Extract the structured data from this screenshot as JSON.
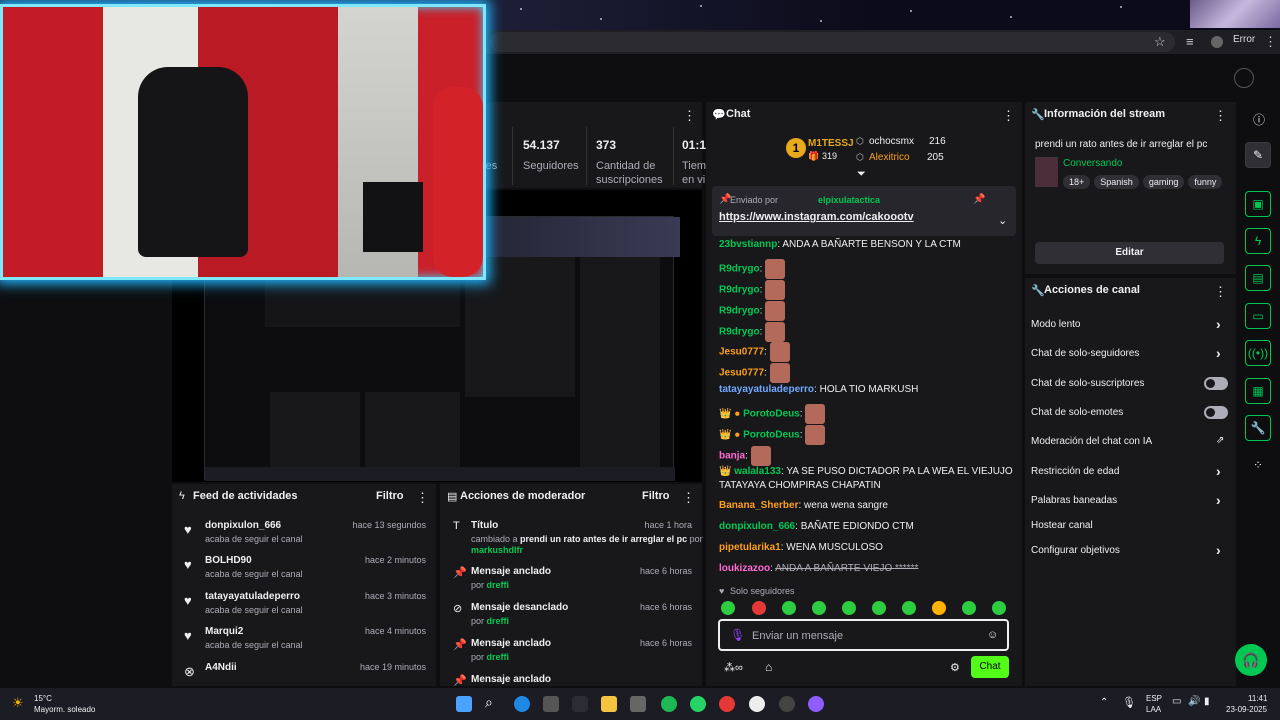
{
  "browser": {
    "error_label": "Error"
  },
  "stats": {
    "partial_label": "res",
    "followers_value": "54.137",
    "followers_label": "Seguidores",
    "subs_value": "373",
    "subs_label_1": "Cantidad de",
    "subs_label_2": "suscripciones",
    "time_value": "01:1",
    "time_label_1": "Tiem",
    "time_label_2": "en vi"
  },
  "chat": {
    "title": "Chat",
    "leader": {
      "rank": "1",
      "name": "M1TESSJ",
      "count": "319"
    },
    "gifter1": {
      "name": "ochocsmx",
      "count": "216"
    },
    "gifter2": {
      "name": "Alexitrico",
      "count": "205"
    },
    "pinned_by_label": "Enviado por",
    "pinned_user": "elpixulatactica",
    "pinned_link": "https://www.instagram.com/cakoootv",
    "messages": [
      {
        "user": "23bvstiannp",
        "text": "ANDA A BAÑARTE BENSON Y LA CTM"
      },
      {
        "user": "R9drygo",
        "text": ""
      },
      {
        "user": "R9drygo",
        "text": ""
      },
      {
        "user": "R9drygo",
        "text": ""
      },
      {
        "user": "R9drygo",
        "text": ""
      },
      {
        "user": "Jesu0777",
        "text": ""
      },
      {
        "user": "Jesu0777",
        "text": ""
      },
      {
        "user": "tatayayatuladeperro",
        "text": "HOLA TIO MARKUSH"
      },
      {
        "user": "PorotoDeus",
        "text": ""
      },
      {
        "user": "PorotoDeus",
        "text": ""
      },
      {
        "user": "banja",
        "text": ""
      },
      {
        "user": "walala133",
        "text": "YA SE PUSO DICTADOR PA LA WEA EL VIEJUJO"
      },
      {
        "user": "",
        "text": "TATAYAYA CHOMPIRAS CHAPATIN"
      },
      {
        "user": "Banana_Sherber",
        "text": "wena wena sangre"
      },
      {
        "user": "donpixulon_666",
        "text": "BAÑATE EDIONDO CTM"
      },
      {
        "user": "pipetularika1",
        "text": "WENA MUSCULOSO"
      },
      {
        "user": "loukizazoo",
        "text": "ANDA A BAÑARTE VIEJO ******"
      }
    ],
    "followers_only": "Solo seguidores",
    "input_placeholder": "Enviar un mensaje",
    "send_label": "Chat"
  },
  "stream_info": {
    "title": "Información del stream",
    "stream_title": "prendi un rato antes de ir arreglar el pc",
    "category": "Conversando",
    "tags": [
      "18+",
      "Spanish",
      "gaming",
      "funny"
    ],
    "edit_label": "Editar"
  },
  "channel_actions": {
    "title": "Acciones de canal",
    "items": [
      {
        "label": "Modo lento"
      },
      {
        "label": "Chat de solo-seguidores"
      },
      {
        "label": "Chat de solo-suscriptores"
      },
      {
        "label": "Chat de solo-emotes"
      },
      {
        "label": "Moderación del chat con IA"
      },
      {
        "label": "Restricción de edad"
      },
      {
        "label": "Palabras baneadas"
      },
      {
        "label": "Hostear canal"
      },
      {
        "label": "Configurar objetivos"
      }
    ]
  },
  "activity_feed": {
    "title": "Feed de actividades",
    "filter_label": "Filtro",
    "items": [
      {
        "user": "donpixulon_666",
        "time": "hace 13 segundos",
        "desc": "acaba de seguir el canal"
      },
      {
        "user": "BOLHD90",
        "time": "hace 2 minutos",
        "desc": "acaba de seguir el canal"
      },
      {
        "user": "tatayayatuladeperro",
        "time": "hace 3 minutos",
        "desc": "acaba de seguir el canal"
      },
      {
        "user": "Marqui2",
        "time": "hace 4 minutos",
        "desc": "acaba de seguir el canal"
      },
      {
        "user": "A4Ndii",
        "time": "hace 19 minutos",
        "desc": ""
      }
    ]
  },
  "mod_actions": {
    "title": "Acciones de moderador",
    "filter_label": "Filtro",
    "items": [
      {
        "action": "Título",
        "time": "hace 1 hora",
        "detail_prefix": "cambiado a",
        "detail_bold": "prendi un rato antes de ir arreglar el pc",
        "by_label": "por",
        "by": "markushdlfr"
      },
      {
        "action": "Mensaje anclado",
        "time": "hace 6 horas",
        "by_label": "por",
        "by": "dreffi"
      },
      {
        "action": "Mensaje desanclado",
        "time": "hace 6 horas",
        "by_label": "por",
        "by": "dreffi"
      },
      {
        "action": "Mensaje anclado",
        "time": "hace 6 horas",
        "by_label": "por",
        "by": "dreffi"
      },
      {
        "action": "Mensaje anclado",
        "time": "",
        "by_label": "",
        "by": ""
      }
    ]
  },
  "taskbar": {
    "weather_temp": "15°C",
    "weather_desc": "Mayorm. soleado",
    "lang": "ESP",
    "lang2": "LAA",
    "time": "11:41",
    "date": "23-09-2025"
  }
}
